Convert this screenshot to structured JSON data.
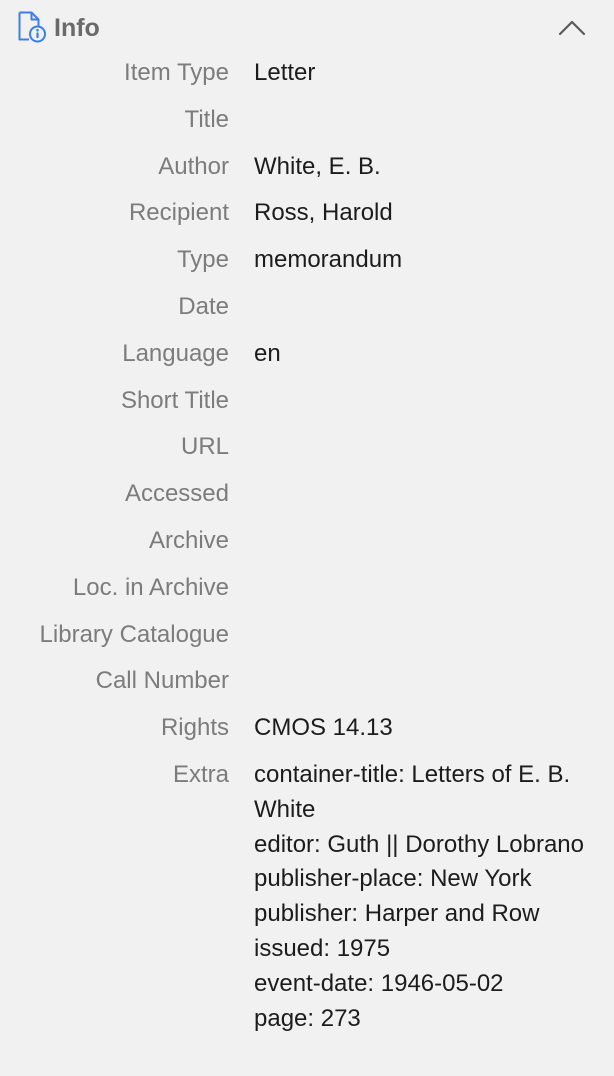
{
  "header": {
    "title": "Info",
    "icon": "document-info-icon",
    "collapse_icon": "chevron-up-icon",
    "accent_color": "#3d7ee6"
  },
  "fields": [
    {
      "label": "Item Type",
      "value": "Letter"
    },
    {
      "label": "Title",
      "value": ""
    },
    {
      "label": "Author",
      "value": "White, E. B."
    },
    {
      "label": "Recipient",
      "value": "Ross, Harold"
    },
    {
      "label": "Type",
      "value": "memorandum"
    },
    {
      "label": "Date",
      "value": ""
    },
    {
      "label": "Language",
      "value": "en"
    },
    {
      "label": "Short Title",
      "value": ""
    },
    {
      "label": "URL",
      "value": ""
    },
    {
      "label": "Accessed",
      "value": ""
    },
    {
      "label": "Archive",
      "value": ""
    },
    {
      "label": "Loc. in Archive",
      "value": ""
    },
    {
      "label": "Library Catalogue",
      "value": ""
    },
    {
      "label": "Call Number",
      "value": ""
    },
    {
      "label": "Rights",
      "value": "CMOS 14.13"
    },
    {
      "label": "Extra",
      "value": "container-title: Letters of E. B. White\neditor: Guth || Dorothy Lobrano\npublisher-place: New York\npublisher: Harper and Row\nissued: 1975\nevent-date: 1946-05-02\npage: 273"
    }
  ]
}
